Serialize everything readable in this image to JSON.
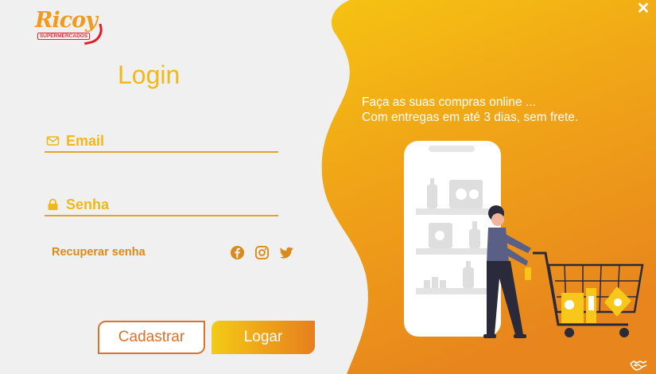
{
  "brand": {
    "logo_text": "Ricoy",
    "logo_subtitle": "SUPERMERCADOS",
    "colors": {
      "red": "#e31b23",
      "orange": "#f29a1f",
      "yellow": "#f0b81b"
    }
  },
  "login": {
    "title": "Login",
    "email_placeholder": "Email",
    "senha_placeholder": "Senha",
    "recover_label": "Recuperar senha",
    "register_label": "Cadastrar",
    "submit_label": "Logar"
  },
  "social": {
    "icons": [
      "facebook-icon",
      "instagram-icon",
      "twitter-icon"
    ]
  },
  "promo": {
    "line1": "Faça as suas compras online ...",
    "line2": "Com entregas em até 3 dias, sem frete."
  },
  "window": {
    "close_symbol": "✕"
  }
}
